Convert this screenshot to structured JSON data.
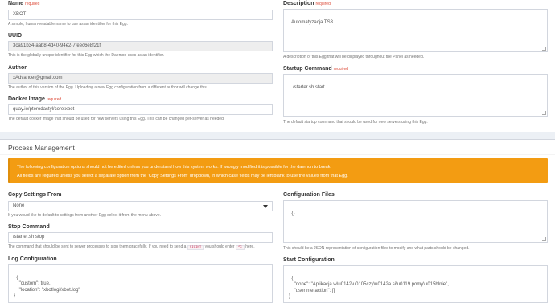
{
  "configuration": {
    "name_label": "Name",
    "name_required": "required",
    "name_value": "XBOT",
    "name_help": "A simple, human-readable name to use as an identifier for this Egg.",
    "uuid_label": "UUID",
    "uuid_value": "3ca91b34-aab8-4d40-94e2-7feec6e8f21f",
    "uuid_help": "This is the globally unique identifier for this Egg which the Daemon uses as an identifier.",
    "author_label": "Author",
    "author_value": "xAdvancet@gmail.com",
    "author_help": "The author of this version of the Egg. Uploading a new Egg configuration from a different author will change this.",
    "docker_label": "Docker Image",
    "docker_required": "required",
    "docker_value": "quay.io/pterodactyl/core:xbot",
    "docker_help": "The default docker image that should be used for new servers using this Egg. This can be changed per-server as needed.",
    "description_label": "Description",
    "description_required": "required",
    "description_value": "Automatyzacja TS3",
    "description_help": "A description of this Egg that will be displayed throughout the Panel as needed.",
    "startup_label": "Startup Command",
    "startup_required": "required",
    "startup_value": "./starter.sh start",
    "startup_help": "The default startup command that should be used for new servers using this Egg."
  },
  "process": {
    "title": "Process Management",
    "warning_line1": "The following configuration options should not be edited unless you understand how this system works. If wrongly modified it is possible for the daemon to break.",
    "warning_line2": "All fields are required unless you select a separate option from the 'Copy Settings From' dropdown, in which case fields may be left blank to use the values from that Egg.",
    "copy_label": "Copy Settings From",
    "copy_selected": "None",
    "copy_help": "If you would like to default to settings from another Egg select it from the menu above.",
    "stop_label": "Stop Command",
    "stop_value": "/starter.sh stop",
    "stop_help_pre": "The command that should be sent to server processes to stop them gracefully. If you need to send a",
    "stop_help_code1": "SIGINT",
    "stop_help_mid": "you should enter",
    "stop_help_code2": "^C",
    "stop_help_post": "here.",
    "log_label": "Log Configuration",
    "log_value": "{\n    \"custom\": true,\n    \"location\": \"xbotlogi/xbot.log\"\n}",
    "files_label": "Configuration Files",
    "files_value": "{}",
    "files_help": "This should be a JSON representation of configuration files to modify and what parts should be changed.",
    "start_label": "Start Configuration",
    "start_value": "{\n    \"done\": \"Aplikacja w\\u0142\\u0105czy\\u0142a si\\u0119 pomy\\u015blnie\",\n    \"userInteraction\": []\n}"
  },
  "colors": {
    "warning_bg": "#f39c12",
    "required": "#dd4b39"
  },
  "icons": {
    "select_caret": "chevron-down-icon"
  }
}
